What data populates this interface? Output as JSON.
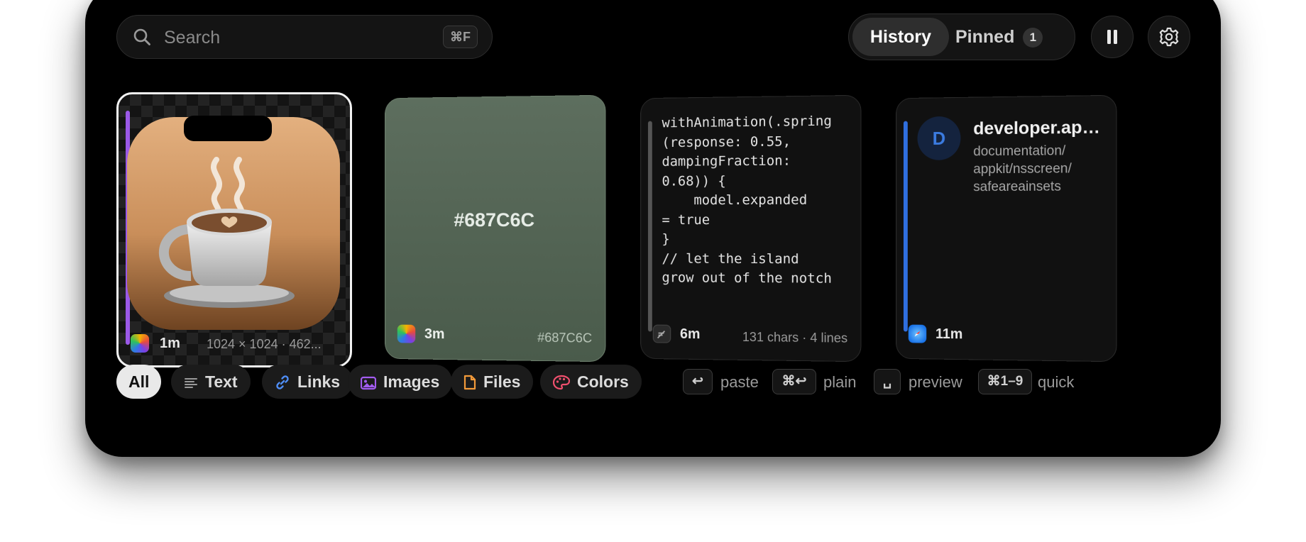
{
  "search": {
    "placeholder": "Search",
    "shortcut": "⌘F"
  },
  "tabs": {
    "history_label": "History",
    "pinned_label": "Pinned",
    "pinned_count": "1",
    "active": "History"
  },
  "cards": [
    {
      "kind": "image",
      "time": "1m",
      "meta": "1024 × 1024 · 462...",
      "accent_color": "#9b59e8",
      "selected": true
    },
    {
      "kind": "color",
      "hex_display": "#687C6C",
      "time": "3m",
      "meta": "#687C6C"
    },
    {
      "kind": "text",
      "code": "withAnimation(.spring\n(response: 0.55,\ndampingFraction:\n0.68)) {\n    model.expanded\n= true\n}\n// let the island\ngrow out of the notch",
      "time": "6m",
      "meta": "131 chars · 4 lines",
      "accent_color": "#555555"
    },
    {
      "kind": "link",
      "avatar_letter": "D",
      "title": "developer.apple.com",
      "path": "documentation/\nappkit/nsscreen/\nsafeareainsets",
      "time": "11m",
      "accent_color": "#2f6fe0"
    }
  ],
  "filters": [
    {
      "label": "All",
      "icon": "",
      "active": true
    },
    {
      "label": "Text",
      "icon": "text-lines-icon",
      "color": "#9a9a9a"
    },
    {
      "label": "Links",
      "icon": "link-icon",
      "color": "#4f8ef7"
    },
    {
      "label": "Images",
      "icon": "photo-icon",
      "color": "#a35cf0"
    },
    {
      "label": "Files",
      "icon": "document-icon",
      "color": "#f29a3a"
    },
    {
      "label": "Colors",
      "icon": "palette-icon",
      "color": "#f0506e"
    }
  ],
  "hints": [
    {
      "key": "↩",
      "label": "paste"
    },
    {
      "key": "⌘↩",
      "label": "plain"
    },
    {
      "key": "␣",
      "label": "preview"
    },
    {
      "key": "⌘1–9",
      "label": "quick"
    }
  ]
}
